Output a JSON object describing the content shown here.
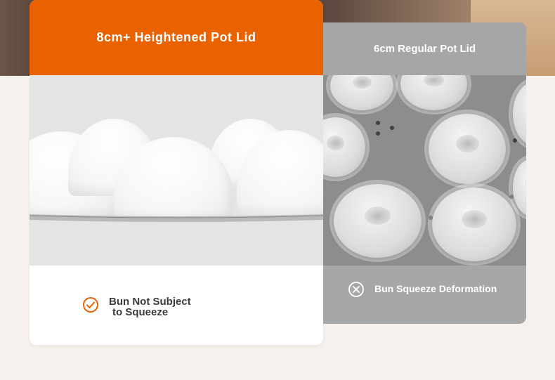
{
  "left_card": {
    "title": "8cm+ Heightened Pot Lid",
    "badge_line1": "Bun Not Subject",
    "badge_line2": "to Squeeze",
    "badge_icon": "check-circle-icon",
    "accent_color": "#ea6100"
  },
  "right_card": {
    "title": "6cm Regular Pot Lid",
    "badge_text": "Bun Squeeze Deformation",
    "badge_icon": "x-circle-icon",
    "accent_color": "#a6a6a6"
  }
}
